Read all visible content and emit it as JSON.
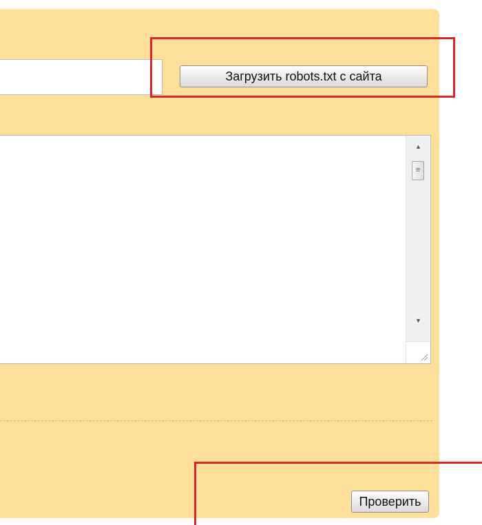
{
  "form": {
    "url_input": {
      "value": "",
      "placeholder": ""
    },
    "load_button_label": "Загрузить robots.txt с сайта",
    "robots_editor": {
      "value": ""
    },
    "check_button_label": "Проверить"
  },
  "icons": {
    "scroll_up": "scroll-up-arrow-icon",
    "scroll_down": "scroll-down-arrow-icon",
    "scroll_thumb": "scroll-thumb-grip-icon",
    "resize": "resize-handle-icon"
  },
  "colors": {
    "panel_background": "#fedf9a",
    "highlight": "#d92626",
    "divider": "#d4b878"
  }
}
